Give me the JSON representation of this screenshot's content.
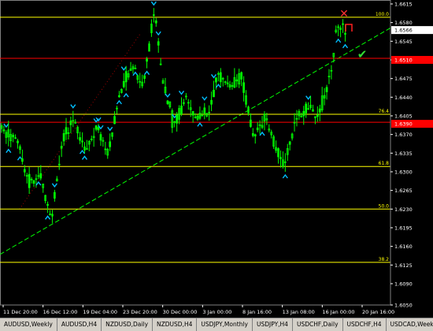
{
  "chart_data": {
    "type": "candlestick",
    "price_scale": {
      "max": 1.6615,
      "min": 1.605,
      "ticks": [
        "1.6615",
        "1.6580",
        "1.6545",
        "1.6510",
        "1.6475",
        "1.6440",
        "1.6405",
        "1.6370",
        "1.6335",
        "1.6300",
        "1.6265",
        "1.6230",
        "1.6195",
        "1.6160",
        "1.6125",
        "1.6090",
        "1.6050"
      ]
    },
    "current_price_label": "1.6566",
    "red_price_labels": [
      "1.6510",
      "1.6390"
    ],
    "time_labels": [
      "11 Dec 20:00",
      "16 Dec 12:00",
      "19 Dec 04:00",
      "23 Dec 20:00",
      "30 Dec 00:00",
      "3 Jan 00:00",
      "8 Jan 16:00",
      "13 Jan 08:00",
      "16 Jan 00:00",
      "20 Jan 16:00"
    ],
    "fib_levels": [
      {
        "label": "100.0",
        "price": 1.659
      },
      {
        "label": "76.4",
        "price": 1.6408
      },
      {
        "label": "61.8",
        "price": 1.631
      },
      {
        "label": "50.0",
        "price": 1.623
      },
      {
        "label": "38.2",
        "price": 1.613
      }
    ],
    "red_levels": [
      1.6513,
      1.6393
    ],
    "trendline": {
      "from": [
        0,
        1.6145
      ],
      "to": [
        1,
        1.657
      ]
    },
    "dotted_line": {
      "from": [
        0.05,
        1.623
      ],
      "to": [
        0.36,
        1.656
      ]
    },
    "colors": {
      "background": "#000000",
      "candle": "#00ff00",
      "fib": "#ffff00",
      "red_level": "#ff0000",
      "grid": "#ffffff",
      "arrow": "#00bfff",
      "trendline": "#00ff00"
    }
  },
  "markers": {
    "cross": "✕",
    "check": "✔"
  },
  "tabs": [
    "AUDUSD,Weekly",
    "AUDUSD,H4",
    "NZDUSD,Daily",
    "NZDUSD,H4",
    "USDJPY,Monthly",
    "USDJPY,H4",
    "USDCHF,Daily",
    "USDCHF,H4",
    "USDCAD,Week"
  ]
}
